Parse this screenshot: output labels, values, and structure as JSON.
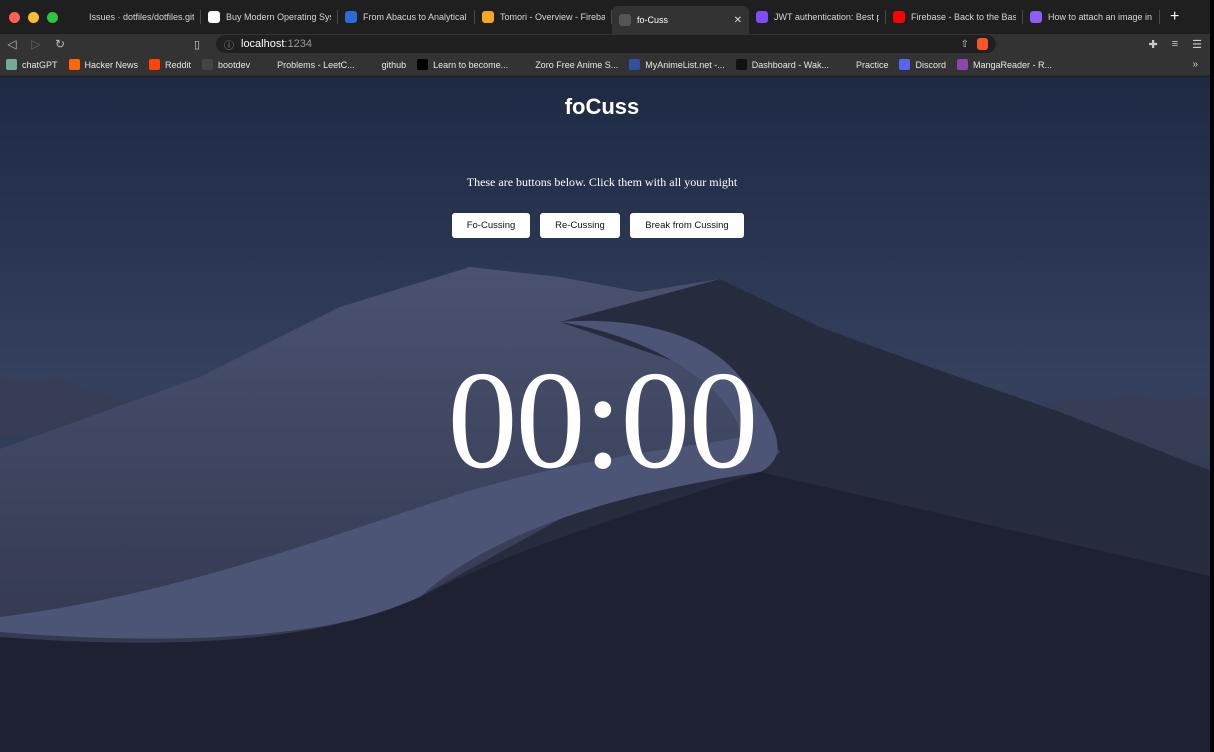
{
  "browser": {
    "tabs": [
      {
        "title": "Issues · dotfiles/dotfiles.git",
        "icon": "github-icon",
        "icon_bg": "#1f1f1f"
      },
      {
        "title": "Buy Modern Operating Sys",
        "icon": "amazon-icon",
        "icon_bg": "#ffffff"
      },
      {
        "title": "From Abacus to Analytical",
        "icon": "c-logo-icon",
        "icon_bg": "#2a6bd8"
      },
      {
        "title": "Tomori - Overview - Fireba",
        "icon": "firebase-icon",
        "icon_bg": "#f5a623"
      },
      {
        "title": "fo-Cuss",
        "icon": "globe-icon",
        "icon_bg": "#555555",
        "active": true
      },
      {
        "title": "JWT authentication: Best p",
        "icon": "jwt-icon",
        "icon_bg": "#7c4dff"
      },
      {
        "title": "Firebase - Back to the Bas",
        "icon": "youtube-icon",
        "icon_bg": "#ff0000"
      },
      {
        "title": "How to attach an image in",
        "icon": "obsidian-icon",
        "icon_bg": "#8e5cf7"
      }
    ],
    "address": {
      "host": "localhost",
      "port": ":1234"
    },
    "bookmarks": [
      {
        "label": "chatGPT",
        "icon": "openai-icon",
        "icon_bg": "#74aa9c"
      },
      {
        "label": "Hacker News",
        "icon": "ycombinator-icon",
        "icon_bg": "#ff6600"
      },
      {
        "label": "Reddit",
        "icon": "reddit-icon",
        "icon_bg": "#ff4500"
      },
      {
        "label": "bootdev",
        "icon": "bootdev-icon",
        "icon_bg": "#444444"
      },
      {
        "label": "Problems - LeetC...",
        "icon": "leetcode-icon",
        "icon_bg": "#333333"
      },
      {
        "label": "github",
        "icon": "github-icon",
        "icon_bg": "#333333"
      },
      {
        "label": "Learn to become...",
        "icon": "roadmap-icon",
        "icon_bg": "#000000"
      },
      {
        "label": "Zoro Free Anime S...",
        "icon": "zoro-icon",
        "icon_bg": "#333333"
      },
      {
        "label": "MyAnimeList.net -...",
        "icon": "mal-icon",
        "icon_bg": "#2e51a2"
      },
      {
        "label": "Dashboard - Wak...",
        "icon": "wakatime-icon",
        "icon_bg": "#111111"
      },
      {
        "label": "Practice",
        "icon": "practice-icon",
        "icon_bg": "#333333"
      },
      {
        "label": "Discord",
        "icon": "discord-icon",
        "icon_bg": "#5865f2"
      },
      {
        "label": "MangaReader - R...",
        "icon": "mangareader-icon",
        "icon_bg": "#8e44ad"
      }
    ],
    "bookmarks_more": "»"
  },
  "app": {
    "title": "foCuss",
    "subtitle": "These are buttons below. Click them with all your might",
    "buttons": {
      "focus": "Fo-Cussing",
      "refocus": "Re-Cussing",
      "break": "Break from Cussing"
    },
    "timer": "00:00"
  }
}
